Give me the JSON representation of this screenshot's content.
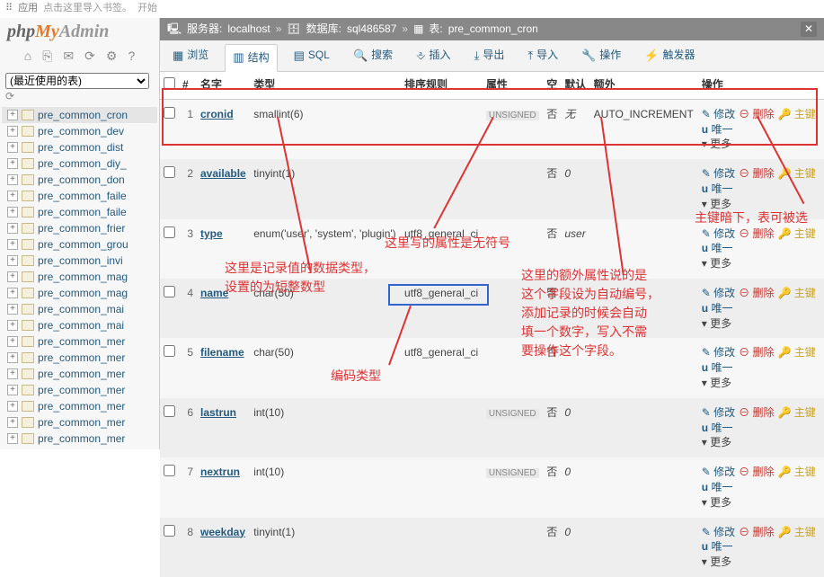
{
  "topbar": {
    "apps_icon": "⠿",
    "apps": "应用",
    "hint": "点击这里导入书签。",
    "start": "开始"
  },
  "logo": {
    "p": "php",
    "m": "My",
    "a": "Admin"
  },
  "sidebar_icons": [
    "⌂",
    "⎘",
    "✉",
    "⟳",
    "⚙",
    "?"
  ],
  "recent": {
    "placeholder": "(最近使用的表)"
  },
  "tree": [
    "pre_common_cron",
    "pre_common_dev",
    "pre_common_dist",
    "pre_common_diy_",
    "pre_common_don",
    "pre_common_faile",
    "pre_common_faile",
    "pre_common_frier",
    "pre_common_grou",
    "pre_common_invi",
    "pre_common_mag",
    "pre_common_mag",
    "pre_common_mai",
    "pre_common_mai",
    "pre_common_mer",
    "pre_common_mer",
    "pre_common_mer",
    "pre_common_mer",
    "pre_common_mer",
    "pre_common_mer",
    "pre_common_mer"
  ],
  "bc": {
    "server_lbl": "服务器:",
    "server": "localhost",
    "db_lbl": "数据库:",
    "db": "sql486587",
    "tbl_lbl": "表:",
    "tbl": "pre_common_cron"
  },
  "tabs": [
    {
      "icon": "▦",
      "label": "浏览"
    },
    {
      "icon": "▥",
      "label": "结构"
    },
    {
      "icon": "▤",
      "label": "SQL"
    },
    {
      "icon": "🔍",
      "label": "搜索"
    },
    {
      "icon": "⎀",
      "label": "插入"
    },
    {
      "icon": "⤓",
      "label": "导出"
    },
    {
      "icon": "⤒",
      "label": "导入"
    },
    {
      "icon": "🔧",
      "label": "操作"
    },
    {
      "icon": "⚡",
      "label": "触发器"
    }
  ],
  "th": {
    "num": "#",
    "name": "名字",
    "type": "类型",
    "collation": "排序规则",
    "attr": "属性",
    "null": "空",
    "default": "默认",
    "extra": "额外",
    "ops": "操作"
  },
  "rows": [
    {
      "n": "1",
      "name": "cronid",
      "type": "smallint(6)",
      "coll": "",
      "attr": "UNSIGNED",
      "nul": "否",
      "def": "无",
      "extra": "AUTO_INCREMENT"
    },
    {
      "n": "2",
      "name": "available",
      "type": "tinyint(1)",
      "coll": "",
      "attr": "",
      "nul": "否",
      "def": "0",
      "extra": ""
    },
    {
      "n": "3",
      "name": "type",
      "type": "enum('user', 'system', 'plugin')",
      "coll": "utf8_general_ci",
      "attr": "",
      "nul": "否",
      "def": "user",
      "extra": ""
    },
    {
      "n": "4",
      "name": "name",
      "type": "char(50)",
      "coll": "utf8_general_ci",
      "attr": "",
      "nul": "否",
      "def": "",
      "extra": ""
    },
    {
      "n": "5",
      "name": "filename",
      "type": "char(50)",
      "coll": "utf8_general_ci",
      "attr": "",
      "nul": "否",
      "def": "",
      "extra": ""
    },
    {
      "n": "6",
      "name": "lastrun",
      "type": "int(10)",
      "coll": "",
      "attr": "UNSIGNED",
      "nul": "否",
      "def": "0",
      "extra": ""
    },
    {
      "n": "7",
      "name": "nextrun",
      "type": "int(10)",
      "coll": "",
      "attr": "UNSIGNED",
      "nul": "否",
      "def": "0",
      "extra": ""
    },
    {
      "n": "8",
      "name": "weekday",
      "type": "tinyint(1)",
      "coll": "",
      "attr": "",
      "nul": "否",
      "def": "0",
      "extra": ""
    }
  ],
  "acts": {
    "edit": "修改",
    "del": "删除",
    "pk": "主键",
    "uni": "唯一",
    "more": "更多"
  },
  "anno": {
    "a1": "这里是记录值的数据类型，\n设置的为短整数型",
    "a2": "这里写的属性是无符号",
    "a3": "这里的额外属性说的是\n这个字段设为自动编号，\n添加记录的时候会自动\n填一个数字，写入不需\n要操作这个字段。",
    "a4": "编码类型",
    "a5": "主键暗下，表可被选"
  }
}
